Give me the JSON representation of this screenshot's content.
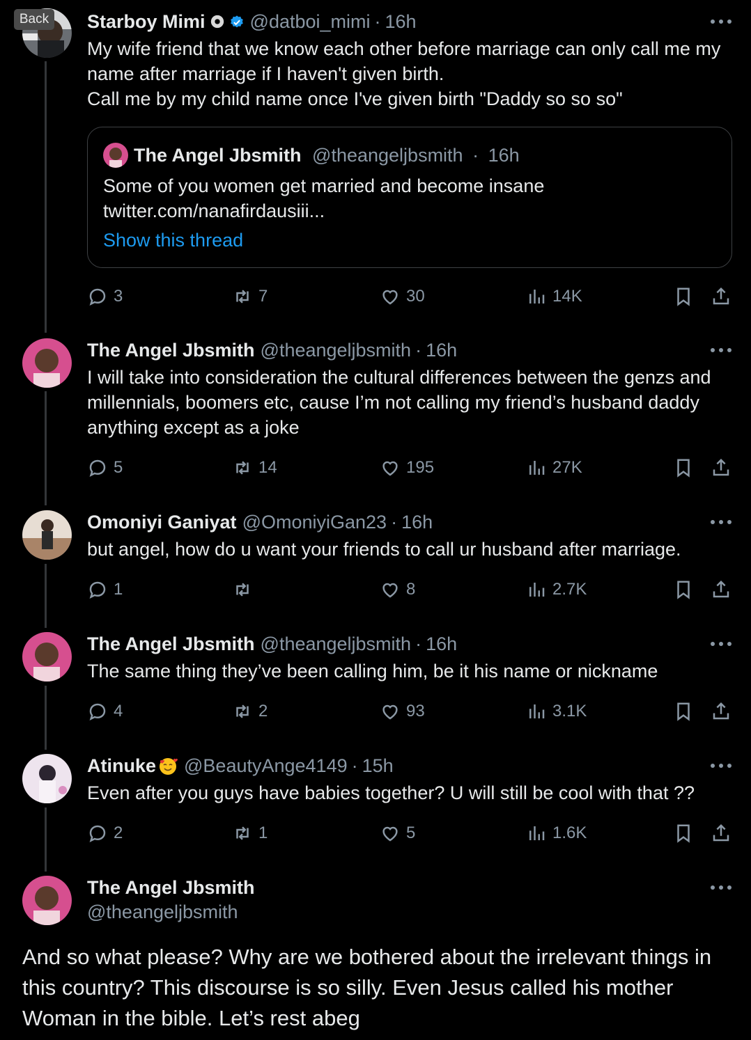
{
  "back_label": "Back",
  "tweets": [
    {
      "name": "Starboy Mimi",
      "handle": "@datboi_mimi",
      "time": "16h",
      "text": "My wife friend that we know each other before marriage can only call me my name after marriage if I haven't given birth.\nCall me by my child name once I've given birth \"Daddy so so so\"",
      "quote": {
        "name": "The Angel Jbsmith",
        "handle": "@theangeljbsmith",
        "time": "16h",
        "text": "Some of you women get married and become insane\ntwitter.com/nanafirdausiii...",
        "link": "Show this thread"
      },
      "replies": "3",
      "retweets": "7",
      "likes": "30",
      "views": "14K"
    },
    {
      "name": "The Angel Jbsmith",
      "handle": "@theangeljbsmith",
      "time": "16h",
      "text": "I will take into consideration the cultural differences between the genzs and millennials, boomers etc, cause I’m not calling my friend’s husband daddy anything except as a joke",
      "replies": "5",
      "retweets": "14",
      "likes": "195",
      "views": "27K"
    },
    {
      "name": "Omoniyi Ganiyat",
      "handle": "@OmoniyiGan23",
      "time": "16h",
      "text": "but angel, how do u want your friends to call ur husband after marriage.",
      "replies": "1",
      "retweets": "",
      "likes": "8",
      "views": "2.7K"
    },
    {
      "name": "The Angel Jbsmith",
      "handle": "@theangeljbsmith",
      "time": "16h",
      "text": "The same thing they’ve been calling him, be it his name or nickname",
      "replies": "4",
      "retweets": "2",
      "likes": "93",
      "views": "3.1K"
    },
    {
      "name": "Atinuke",
      "handle": "@BeautyAnge4149",
      "time": "15h",
      "text": "Even after you guys have babies together? U will still be cool with that ??",
      "replies": "2",
      "retweets": "1",
      "likes": "5",
      "views": "1.6K"
    }
  ],
  "main_tweet": {
    "name": "The Angel Jbsmith",
    "handle": "@theangeljbsmith",
    "text": "And so what please? Why are we bothered about the irrelevant things in this country? This discourse is so silly. Even Jesus called his mother Woman in the bible. Let’s rest abeg"
  },
  "icons": {
    "reply": "reply-icon",
    "retweet": "retweet-icon",
    "like": "heart-icon",
    "views": "views-icon",
    "bookmark": "bookmark-icon",
    "share": "share-icon",
    "more": "more-icon"
  },
  "colors": {
    "background": "#000000",
    "text": "#e7e9ea",
    "muted": "#8b98a5",
    "link": "#1d9bf0",
    "verified": "#1d9bf0"
  }
}
